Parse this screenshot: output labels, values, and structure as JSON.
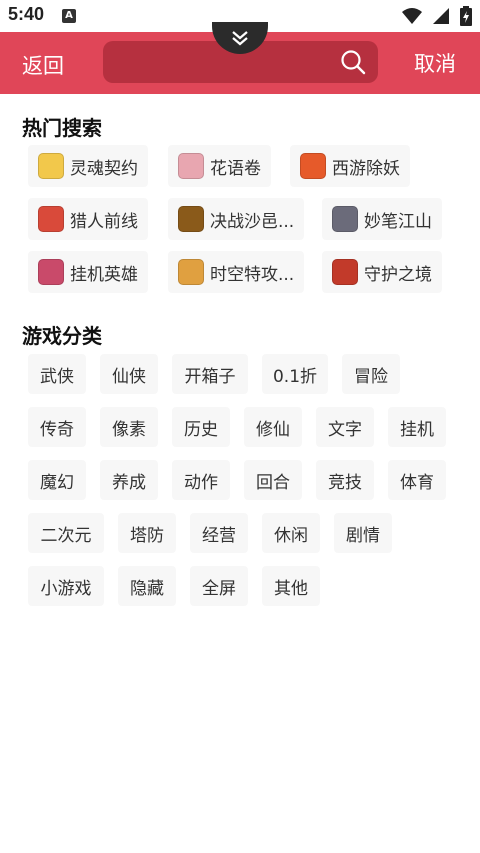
{
  "status_bar": {
    "time": "5:40",
    "notification_badge": "A"
  },
  "header": {
    "back_label": "返回",
    "cancel_label": "取消",
    "search": {
      "placeholder": "",
      "value": ""
    }
  },
  "colors": {
    "accent": "#e04658",
    "search_bg": "#b6303f"
  },
  "hot_search": {
    "title": "热门搜索",
    "items": [
      {
        "label": "灵魂契约",
        "icon": "game-icon-linghun",
        "color": "#f2c84b"
      },
      {
        "label": "花语卷",
        "icon": "game-icon-huayu",
        "color": "#e8a6b0"
      },
      {
        "label": "西游除妖",
        "icon": "game-icon-xiyou",
        "color": "#e65a2a"
      },
      {
        "label": "猎人前线",
        "icon": "game-icon-lieren",
        "color": "#d94a3a"
      },
      {
        "label": "决战沙邑...",
        "icon": "game-icon-juezhan",
        "color": "#8a5a1a"
      },
      {
        "label": "妙笔江山",
        "icon": "game-icon-miaobi",
        "color": "#6b6b7a"
      },
      {
        "label": "挂机英雄",
        "icon": "game-icon-guaji",
        "color": "#c94a6a"
      },
      {
        "label": "时空特攻...",
        "icon": "game-icon-shikong",
        "color": "#e0a040"
      },
      {
        "label": "守护之境",
        "icon": "game-icon-shouhu",
        "color": "#c23a2a"
      }
    ]
  },
  "categories": {
    "title": "游戏分类",
    "items": [
      "武侠",
      "仙侠",
      "开箱子",
      "0.1折",
      "冒险",
      "传奇",
      "像素",
      "历史",
      "修仙",
      "文字",
      "挂机",
      "魔幻",
      "养成",
      "动作",
      "回合",
      "竞技",
      "体育",
      "二次元",
      "塔防",
      "经营",
      "休闲",
      "剧情",
      "小游戏",
      "隐藏",
      "全屏",
      "其他"
    ]
  }
}
